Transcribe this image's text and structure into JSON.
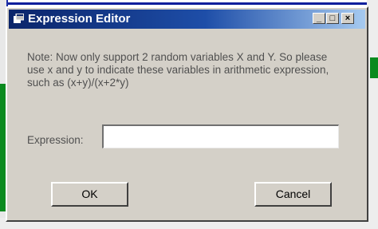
{
  "window": {
    "title": "Expression Editor",
    "minimize_glyph": "_",
    "maximize_glyph": "□",
    "close_glyph": "×"
  },
  "note": "Note: Now only support 2 random variables X and Y. So please\nuse x and y to indicate these variables in arithmetic expression,\nsuch as (x+y)/(x+2*y)",
  "expression": {
    "label": "Expression:",
    "value": ""
  },
  "buttons": {
    "ok": "OK",
    "cancel": "Cancel"
  },
  "colors": {
    "titlebar_start": "#0a246a",
    "titlebar_end": "#a6caf0",
    "dialog_face": "#d4d0c8"
  },
  "icons": {
    "title": "window-app-icon"
  }
}
